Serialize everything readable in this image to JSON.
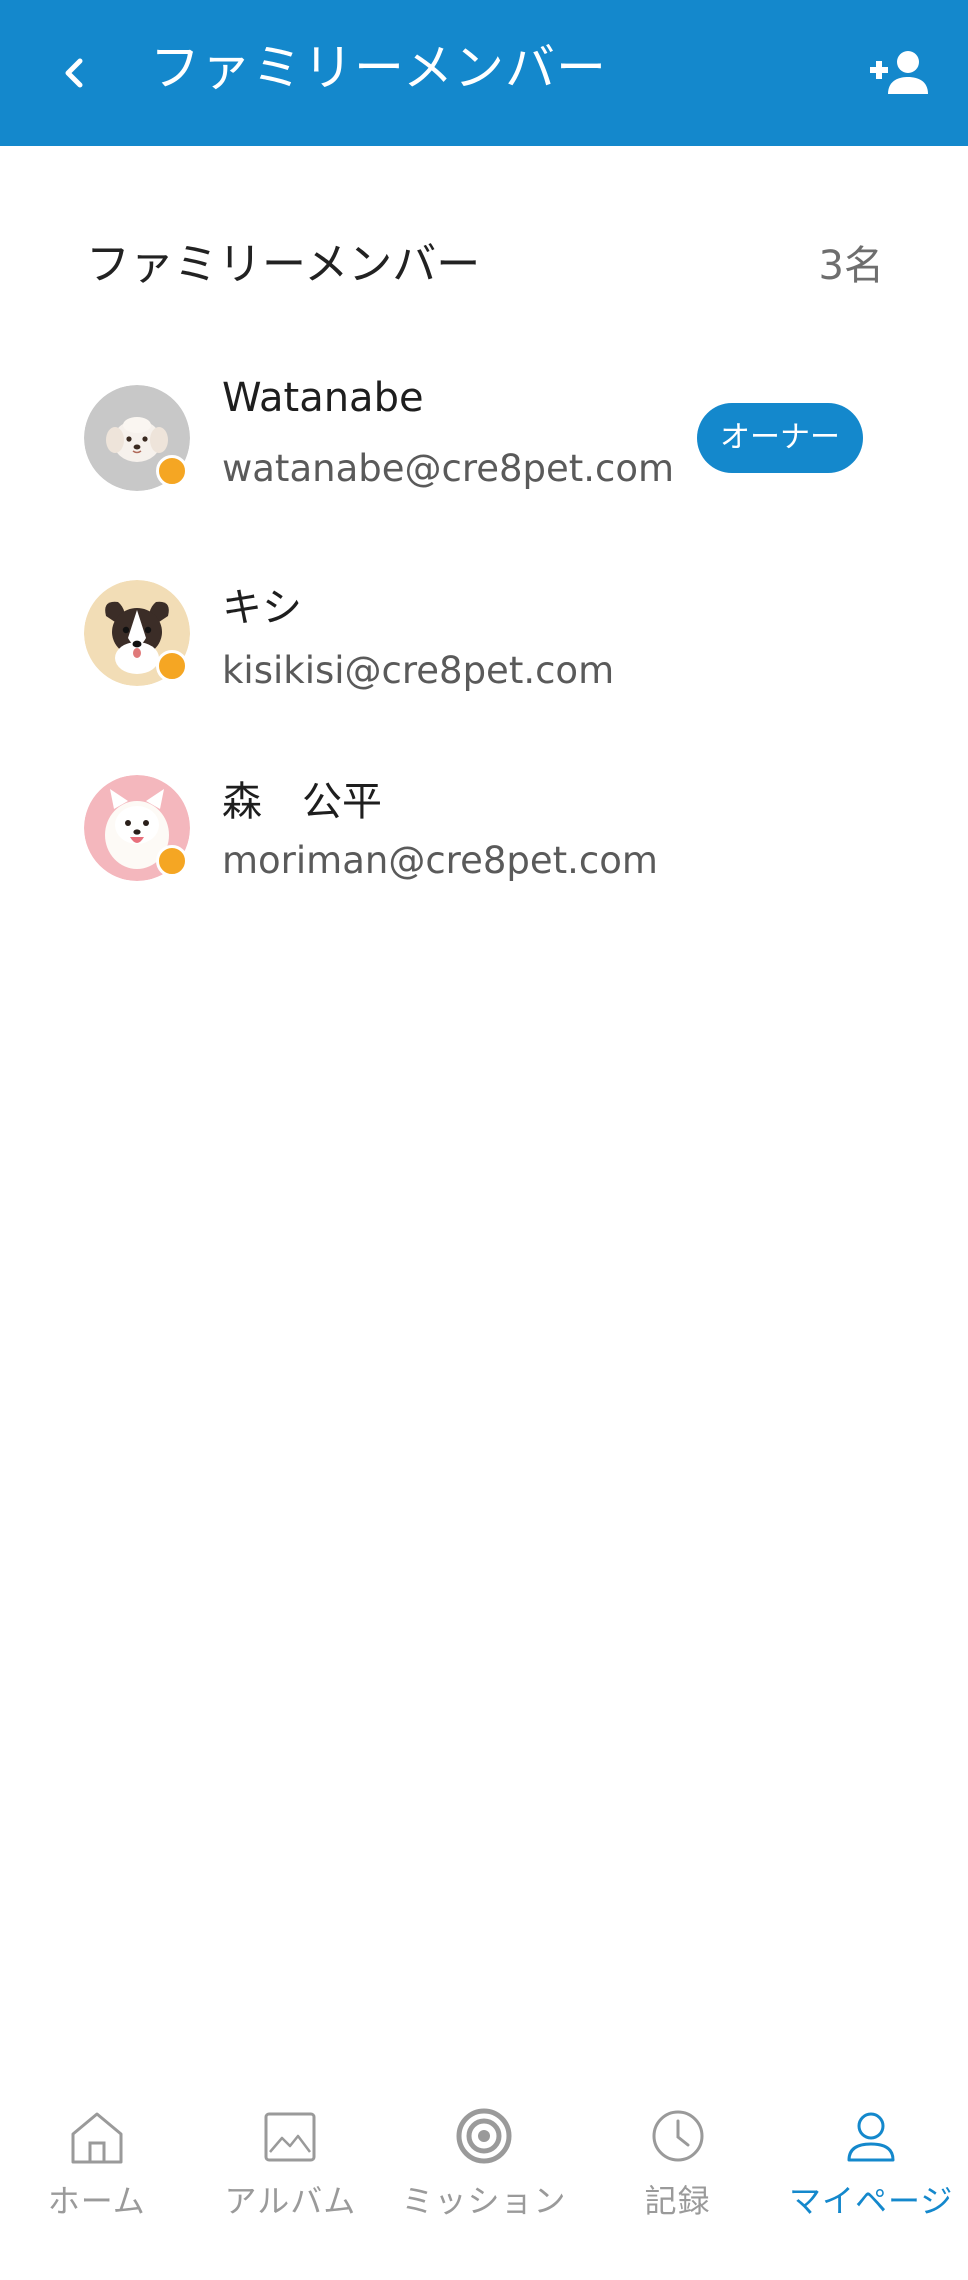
{
  "header": {
    "title": "ファミリーメンバー",
    "back_icon": "chevron-left-icon",
    "add_icon": "person-add-icon"
  },
  "section": {
    "title": "ファミリーメンバー",
    "count": "3名"
  },
  "members": [
    {
      "name": "Watanabe",
      "email": "watanabe@cre8pet.com",
      "role": "オーナー",
      "avatar": "white-dog-avatar"
    },
    {
      "name": "キシ",
      "email": "kisikisi@cre8pet.com",
      "avatar": "border-collie-avatar"
    },
    {
      "name": "森　公平",
      "email": "moriman@cre8pet.com",
      "avatar": "pomeranian-avatar"
    }
  ],
  "nav": {
    "items": [
      {
        "label": "ホーム",
        "icon": "home-icon"
      },
      {
        "label": "アルバム",
        "icon": "album-icon"
      },
      {
        "label": "ミッション",
        "icon": "target-icon"
      },
      {
        "label": "記録",
        "icon": "clock-icon"
      },
      {
        "label": "マイページ",
        "icon": "user-icon",
        "active": true
      }
    ]
  },
  "colors": {
    "primary": "#1488cc",
    "badge": "#f5a623",
    "inactive": "#9a9a9a"
  }
}
